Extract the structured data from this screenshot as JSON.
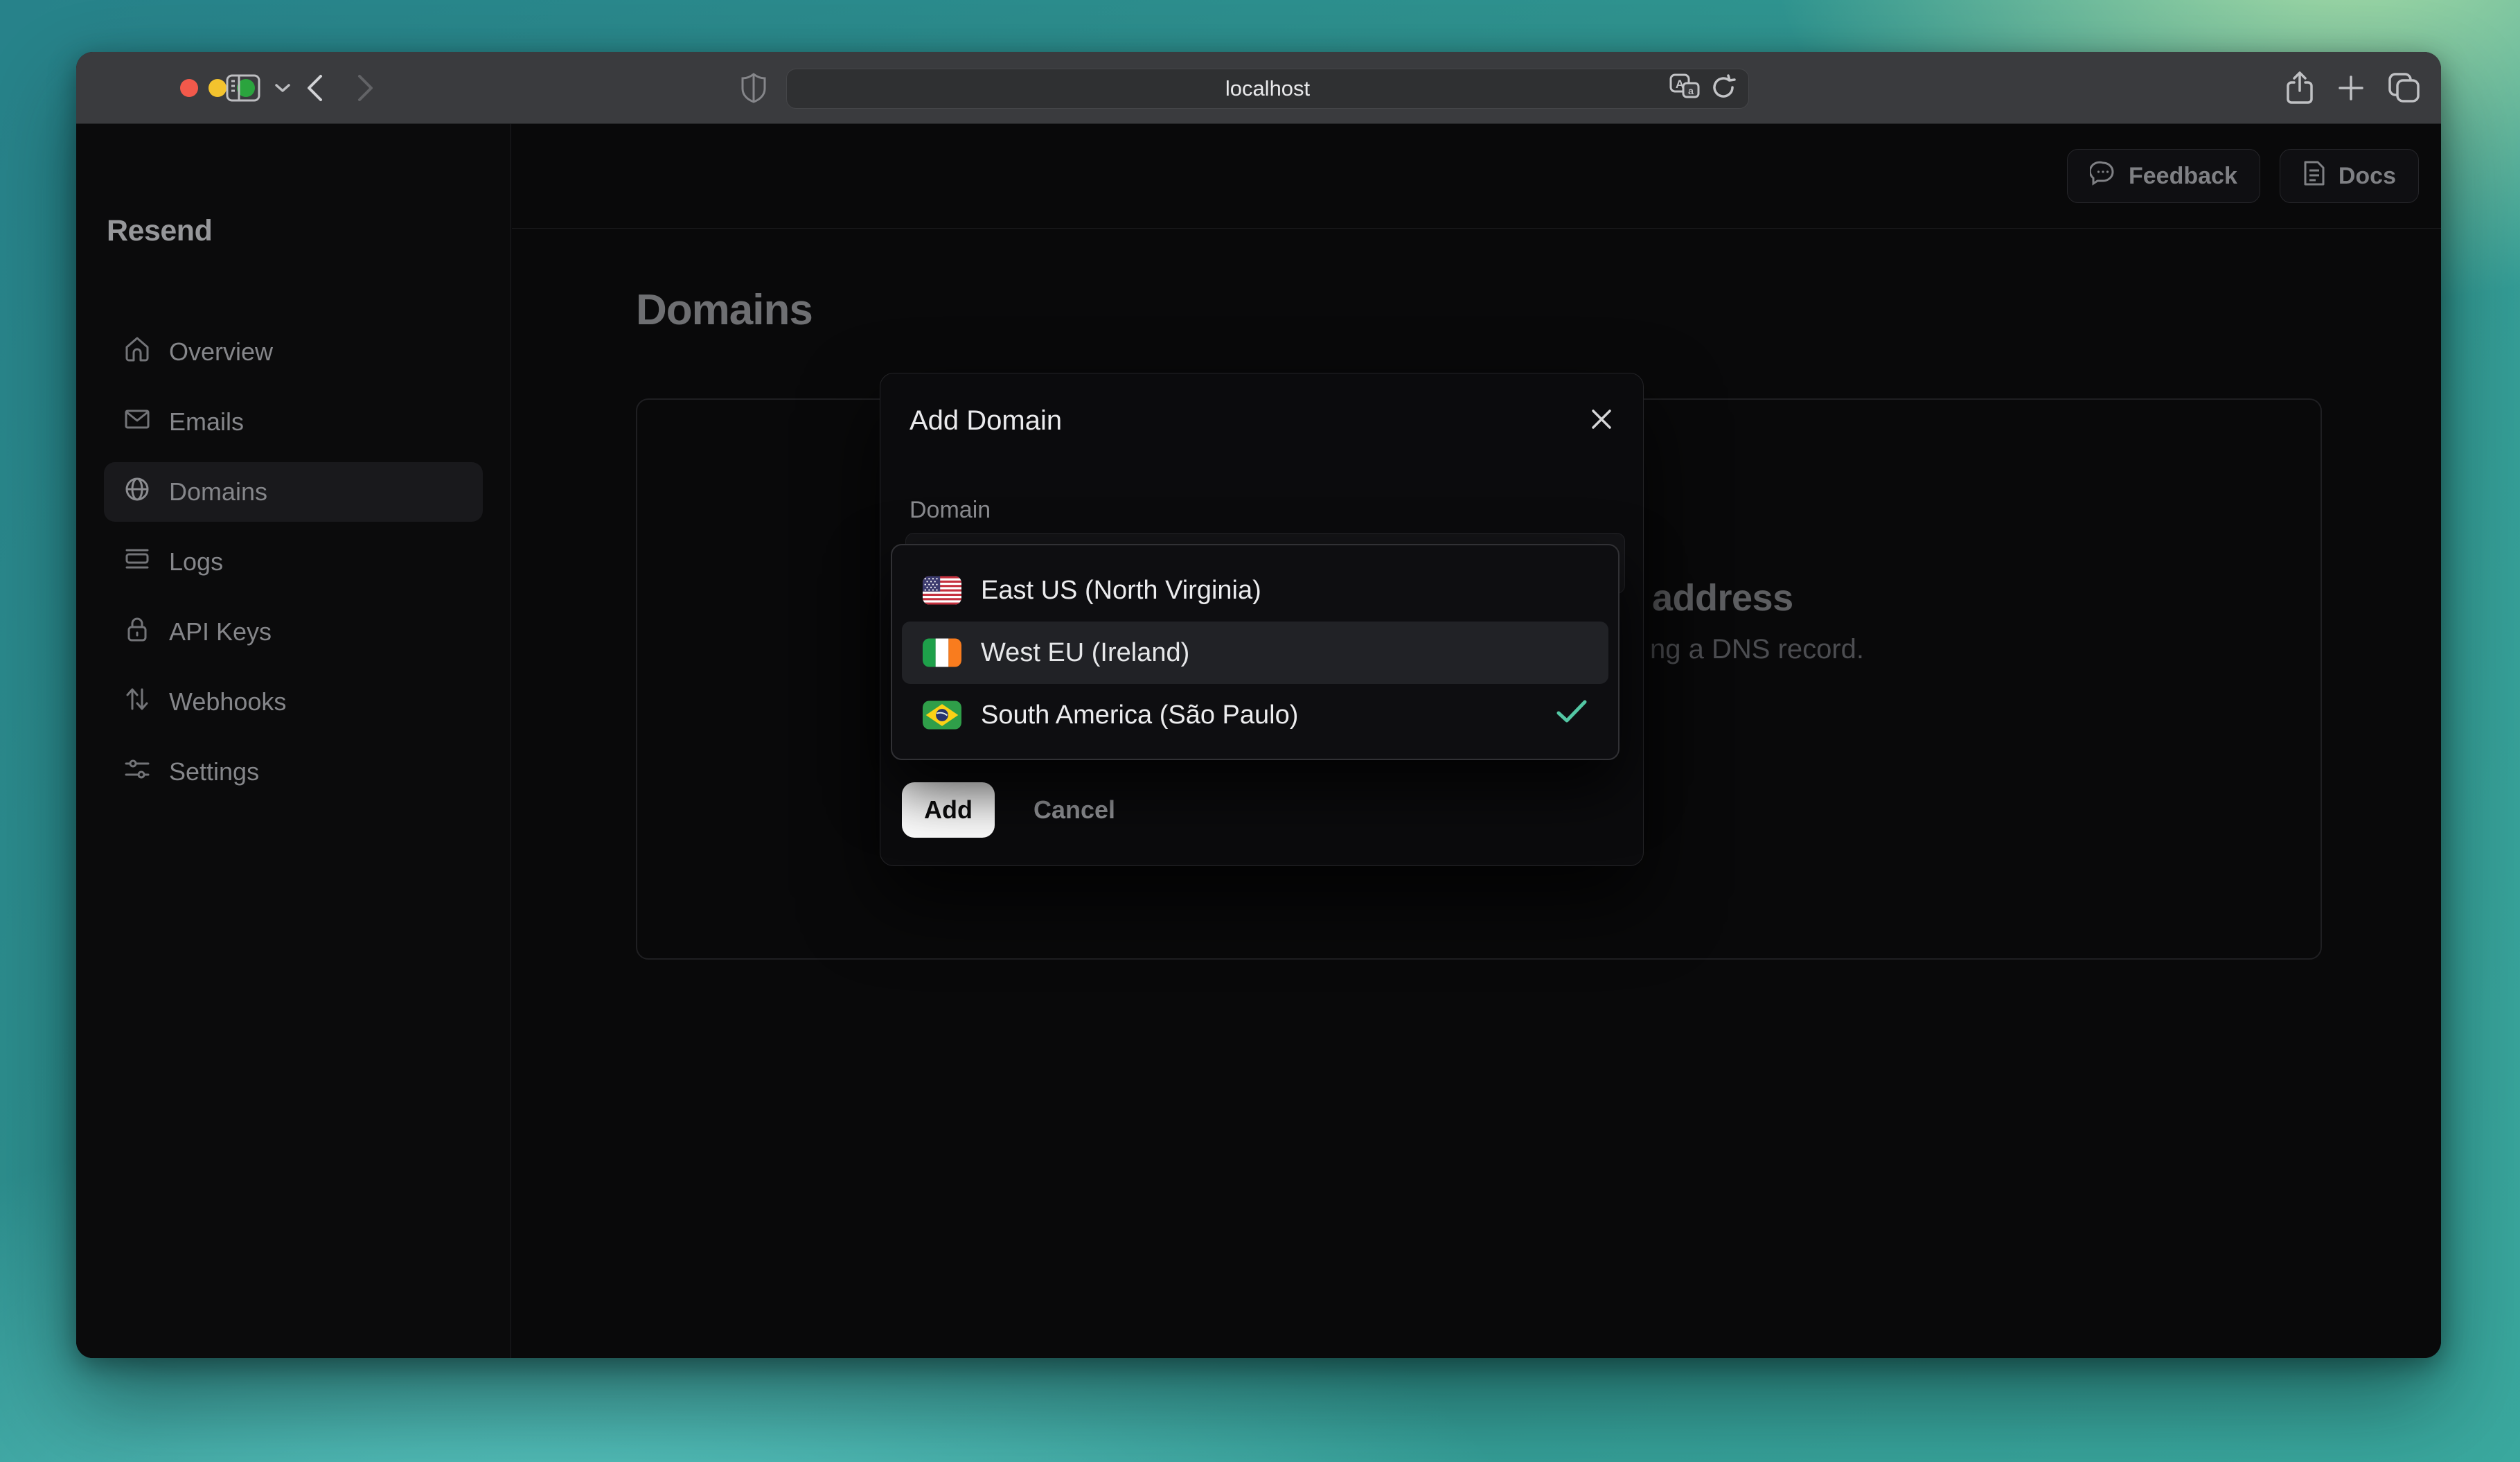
{
  "browser": {
    "url": "localhost",
    "window_controls": {
      "close": "close",
      "minimize": "minimize",
      "zoom": "zoom"
    }
  },
  "sidebar": {
    "logo": "Resend",
    "items": [
      {
        "label": "Overview",
        "icon": "home-icon",
        "active": false
      },
      {
        "label": "Emails",
        "icon": "mail-icon",
        "active": false
      },
      {
        "label": "Domains",
        "icon": "globe-icon",
        "active": true
      },
      {
        "label": "Logs",
        "icon": "logs-icon",
        "active": false
      },
      {
        "label": "API Keys",
        "icon": "lock-icon",
        "active": false
      },
      {
        "label": "Webhooks",
        "icon": "arrows-up-down-icon",
        "active": false
      },
      {
        "label": "Settings",
        "icon": "sliders-icon",
        "active": false
      }
    ]
  },
  "header": {
    "feedback_label": "Feedback",
    "docs_label": "Docs"
  },
  "main": {
    "page_title": "Domains",
    "card": {
      "heading_visible_fragment": "address",
      "body_visible_fragment": "ng a DNS record."
    }
  },
  "modal": {
    "title": "Add Domain",
    "field_label": "Domain",
    "field_value": "",
    "add_label": "Add",
    "cancel_label": "Cancel"
  },
  "dropdown": {
    "options": [
      {
        "label": "East US (North Virginia)",
        "flag": "us-flag-icon",
        "selected": false,
        "highlighted": false
      },
      {
        "label": "West EU (Ireland)",
        "flag": "ireland-flag-icon",
        "selected": false,
        "highlighted": true
      },
      {
        "label": "South America (São Paulo)",
        "flag": "brazil-flag-icon",
        "selected": true,
        "highlighted": false
      }
    ]
  },
  "colors": {
    "check_accent": "#53c7a4",
    "traffic_red": "#f2594b",
    "traffic_yellow": "#f3c32e",
    "traffic_green": "#2ba43e",
    "desktop_teal": "#2f938f",
    "desktop_green": "#a9dda6"
  }
}
